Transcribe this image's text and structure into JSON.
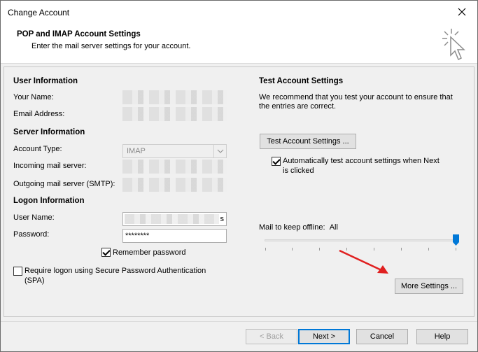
{
  "window": {
    "title": "Change Account"
  },
  "header": {
    "title": "POP and IMAP Account Settings",
    "subtitle": "Enter the mail server settings for your account."
  },
  "user_info": {
    "heading": "User Information",
    "name_label": "Your Name:",
    "email_label": "Email Address:"
  },
  "server_info": {
    "heading": "Server Information",
    "account_type_label": "Account Type:",
    "account_type_value": "IMAP",
    "incoming_label": "Incoming mail server:",
    "outgoing_label": "Outgoing mail server (SMTP):"
  },
  "logon_info": {
    "heading": "Logon Information",
    "username_label": "User Name:",
    "username_tail": "s",
    "password_label": "Password:",
    "password_value": "********",
    "remember_label": "Remember password",
    "remember_checked": true,
    "spa_label_line1": "Require logon using Secure Password Authentication",
    "spa_label_line2": "(SPA)",
    "spa_checked": false
  },
  "test_settings": {
    "heading": "Test Account Settings",
    "desc_line1": "We recommend that you test your account to ensure that",
    "desc_line2": "the entries are correct.",
    "test_button": "Test Account Settings ...",
    "auto_test_line1": "Automatically test account settings when Next",
    "auto_test_line2": "is clicked",
    "auto_test_checked": true
  },
  "offline": {
    "label": "Mail to keep offline:",
    "value": "All",
    "slider_fraction": 1.0
  },
  "more_settings_button": "More Settings ...",
  "footer": {
    "back": "< Back",
    "next": "Next >",
    "cancel": "Cancel",
    "help": "Help"
  },
  "colors": {
    "annotation_arrow": "#e02020",
    "accent": "#0078d7"
  }
}
